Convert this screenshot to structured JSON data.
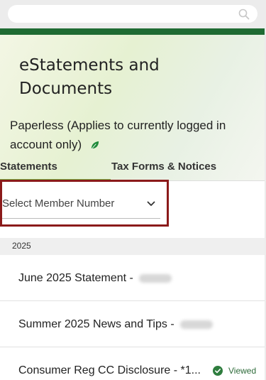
{
  "search": {
    "placeholder": ""
  },
  "header": {
    "title": "eStatements and Documents",
    "paperless_text": "Paperless (Applies to currently logged in account only)"
  },
  "tabs": [
    {
      "label": "Statements",
      "active": true
    },
    {
      "label": "Tax Forms & Notices",
      "active": false
    }
  ],
  "member_select": {
    "label": "Select Member Number"
  },
  "groups": [
    {
      "year": "2025",
      "items": [
        {
          "title": "June 2025 Statement - ",
          "viewed": false
        },
        {
          "title": "Summer 2025 News and Tips - ",
          "viewed": false
        },
        {
          "title": "Consumer Reg CC Disclosure - *1...",
          "viewed": true,
          "viewed_label": "Viewed"
        }
      ]
    }
  ],
  "colors": {
    "brand_green": "#1f6b33",
    "tab_underline": "#7ab648",
    "highlight_border": "#8b1a1a"
  },
  "icons": {
    "search": "search-icon",
    "leaf": "leaf-icon",
    "chevron": "chevron-down-icon",
    "viewed": "check-circle-icon"
  }
}
